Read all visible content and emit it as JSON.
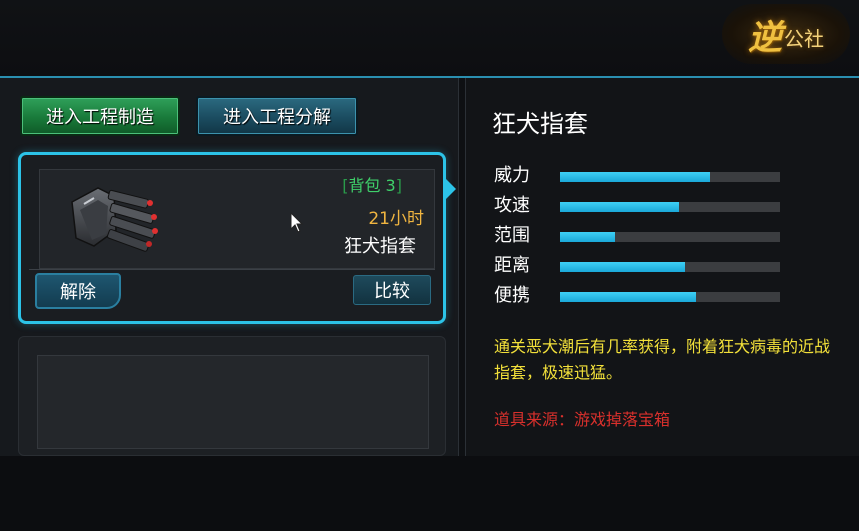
{
  "logo": {
    "text_main": "逆",
    "text_rest": "公社"
  },
  "buttons": {
    "make": "进入工程制造",
    "decompose": "进入工程分解",
    "remove": "解除",
    "compare": "比较"
  },
  "item_card": {
    "bag_tag_open": "[",
    "bag_tag_text": "背包 3",
    "bag_tag_close": "]",
    "timer": "21小时",
    "name": "狂犬指套"
  },
  "detail": {
    "title": "狂犬指套",
    "stats": [
      {
        "label": "威力",
        "value": 0.68
      },
      {
        "label": "攻速",
        "value": 0.54
      },
      {
        "label": "范围",
        "value": 0.25
      },
      {
        "label": "距离",
        "value": 0.57
      },
      {
        "label": "便携",
        "value": 0.62
      }
    ],
    "description": "通关恶犬潮后有几率获得，附着狂犬病毒的近战指套，极速迅猛。",
    "source": "道具来源：游戏掉落宝箱"
  },
  "colors": {
    "accent": "#2cc3e8",
    "stat_fill": "#1aa8d8",
    "description": "#f2e03a",
    "source": "#d8302c",
    "timer": "#f0b540",
    "bag_tag": "#3fd06a"
  },
  "icons": {
    "item": "gauntlet-item-icon",
    "cursor": "mouse-pointer-icon"
  }
}
